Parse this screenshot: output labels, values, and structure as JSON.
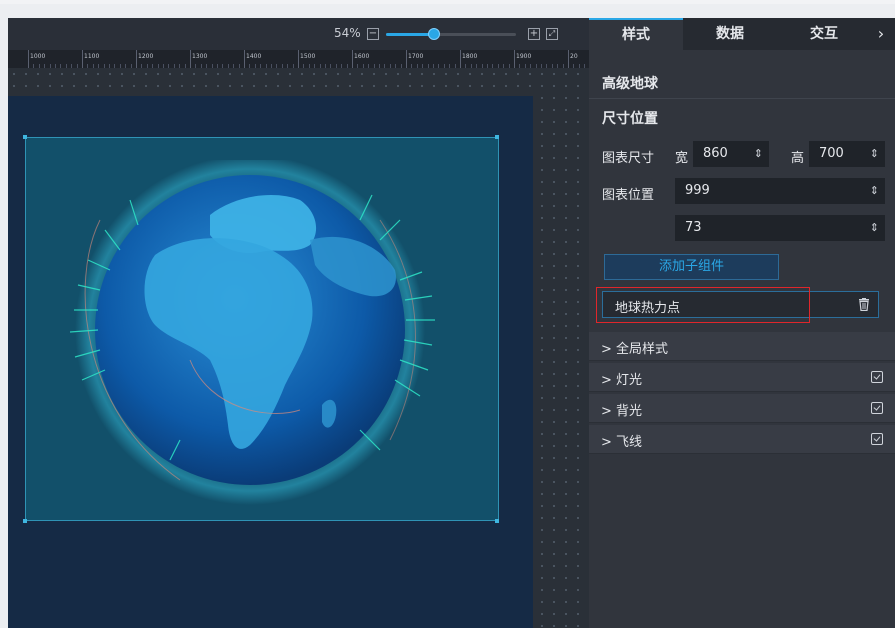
{
  "toolbar": {
    "zoom_label": "54%",
    "zoom_value": 54
  },
  "ruler": {
    "labels": [
      "1000",
      "1100",
      "1200",
      "1300",
      "1400",
      "1500",
      "1600",
      "1700",
      "1800",
      "1900",
      "20"
    ]
  },
  "panel": {
    "tabs": [
      {
        "label": "样式"
      },
      {
        "label": "数据"
      },
      {
        "label": "交互"
      }
    ],
    "component_title": "高级地球",
    "size_section": "尺寸位置",
    "size_label": "图表尺寸",
    "width_label": "宽",
    "width_value": "860",
    "height_label": "高",
    "height_value": "700",
    "pos_label": "图表位置",
    "x_value": "999",
    "y_value": "73",
    "add_child_label": "添加子组件",
    "child_item": "地球热力点",
    "accordion": [
      {
        "label": "> 全局样式",
        "checkbox": false
      },
      {
        "label": "> 灯光",
        "checkbox": true
      },
      {
        "label": "> 背光",
        "checkbox": true
      },
      {
        "label": "> 飞线",
        "checkbox": true
      }
    ]
  },
  "colors": {
    "accent": "#2aa7e6",
    "highlight": "#e0262b",
    "panel": "#31353d",
    "screen": "#152a45"
  }
}
